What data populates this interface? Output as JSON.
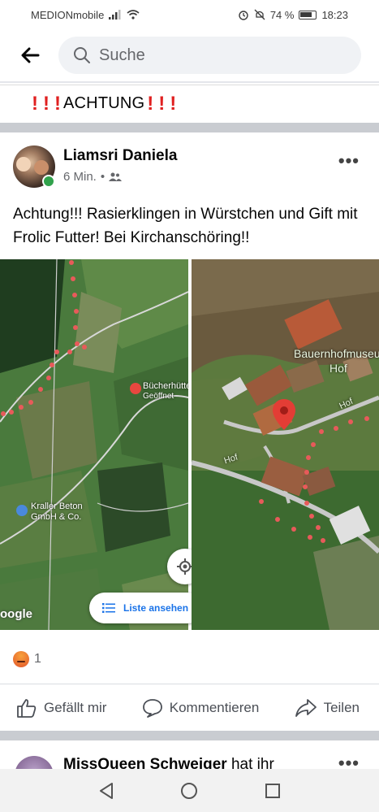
{
  "status_bar": {
    "carrier": "MEDIONmobile",
    "battery_percent": "74 %",
    "time": "18:23"
  },
  "search": {
    "placeholder": "Suche"
  },
  "group_title": {
    "text": "ACHTUNG"
  },
  "post": {
    "author": "Liamsri Daniela",
    "time": "6 Min.",
    "separator": "•",
    "text": "Achtung!!! Rasierklingen in Würstchen und Gift mit Frolic Futter! Bei Kirchanschöring!!",
    "more": "•••",
    "map_left": {
      "place1": "Bücherhütte",
      "place1_status": "Geöffnet",
      "place2_line1": "Kraller Beton",
      "place2_line2": "GmbH & Co.",
      "list_button": "Liste ansehen",
      "watermark": "oogle"
    },
    "map_right": {
      "poi_line1": "Bauernhofmuseum",
      "poi_line2": "Hof",
      "road1": "Hof",
      "road2": "Hof"
    },
    "reaction_count": "1",
    "actions": {
      "like": "Gefällt mir",
      "comment": "Kommentieren",
      "share": "Teilen"
    }
  },
  "next_post": {
    "author": "MissQueen Schweiger",
    "suffix": "hat ihr",
    "more": "•••"
  },
  "colors": {
    "accent_blue": "#1a73e8",
    "online_green": "#31a24c",
    "alert_red": "#e02020"
  }
}
